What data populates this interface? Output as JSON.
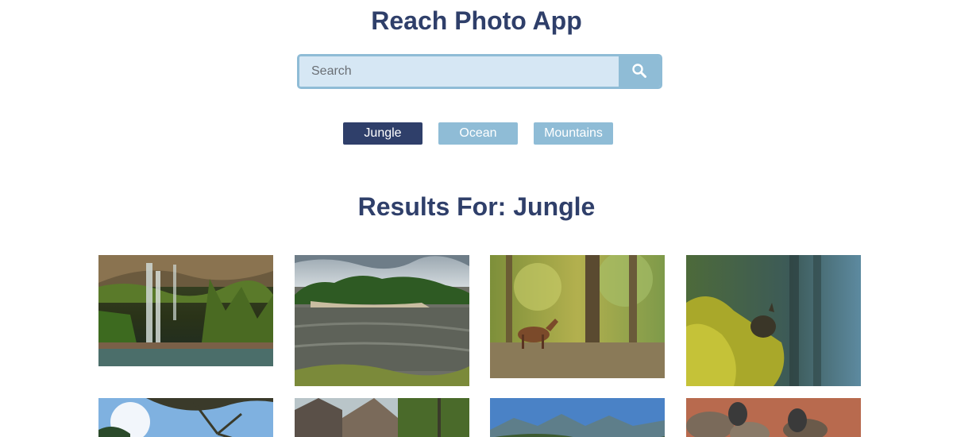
{
  "app": {
    "title": "Reach Photo App"
  },
  "search": {
    "placeholder": "Search",
    "value": "",
    "icon": "search-icon"
  },
  "categories": [
    {
      "label": "Jungle",
      "active": true
    },
    {
      "label": "Ocean",
      "active": false
    },
    {
      "label": "Mountains",
      "active": false
    }
  ],
  "results": {
    "title": "Results For: Jungle"
  },
  "colors": {
    "primary": "#2f3f6a",
    "accent": "#8fbcd6",
    "input_bg": "#d6e7f4"
  }
}
